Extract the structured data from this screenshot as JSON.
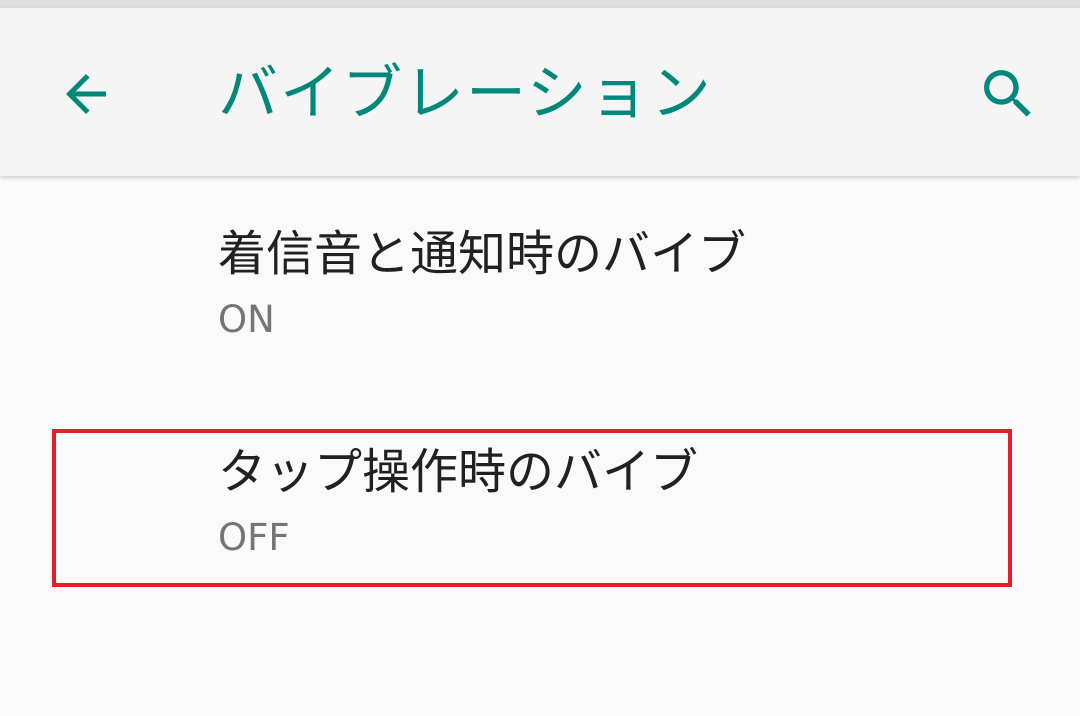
{
  "colors": {
    "accent": "#00897b",
    "title_text": "#212121",
    "summary_text": "#757575",
    "app_bar_bg": "#f5f5f5",
    "page_bg": "#fafafa",
    "highlight": "#e3202a"
  },
  "app_bar": {
    "back_icon": "arrow-back-icon",
    "title": "バイブレーション",
    "search_icon": "search-icon"
  },
  "preferences": [
    {
      "title": "着信音と通知時のバイブ",
      "summary": "ON"
    },
    {
      "title": "タップ操作時のバイブ",
      "summary": "OFF",
      "highlighted": true
    }
  ]
}
